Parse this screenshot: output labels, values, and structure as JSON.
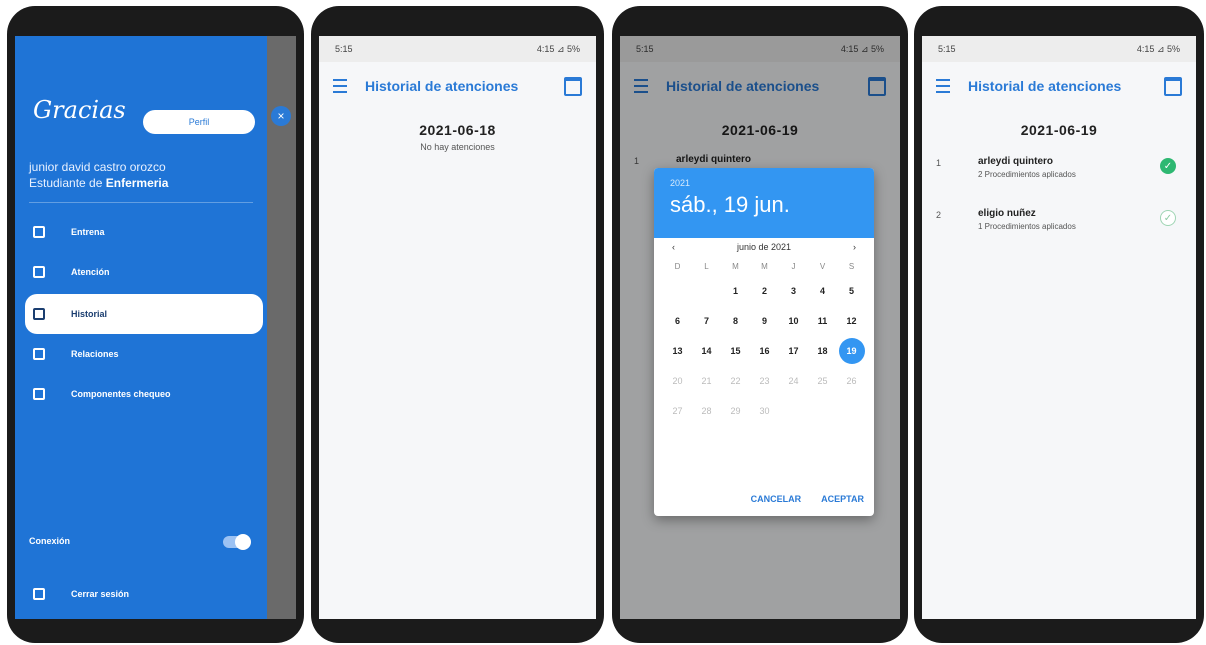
{
  "status": {
    "time": "5:15",
    "right": "4:15 ⊿ 5%"
  },
  "appbar_title": "Historial de atenciones",
  "drawer": {
    "logo": "Gracias",
    "profile_button": "Perfil",
    "close_glyph": "×",
    "user_name": "junior david castro orozco",
    "role_prefix": "Estudiante de",
    "role_bold": "Enfermeria",
    "items": [
      {
        "label": "Entrena",
        "icon": "calendar-icon"
      },
      {
        "label": "Atención",
        "icon": "person-icon"
      },
      {
        "label": "Historial",
        "icon": "history-icon"
      },
      {
        "label": "Relaciones",
        "icon": "relations-icon"
      },
      {
        "label": "Componentes chequeo",
        "icon": "checklist-icon"
      }
    ],
    "connection_label": "Conexión",
    "logout_label": "Cerrar sesión"
  },
  "screen2": {
    "date": "2021-06-18",
    "empty": "No hay atenciones"
  },
  "screen3": {
    "date": "2021-06-19",
    "behind_name": "arleydi quintero",
    "behind_num": "1",
    "dialog": {
      "year": "2021",
      "bigdate": "sáb., 19 jun.",
      "month": "junio de 2021",
      "prev": "‹",
      "next": "›",
      "dows": [
        "D",
        "L",
        "M",
        "M",
        "J",
        "V",
        "S"
      ],
      "days": [
        "",
        "",
        "1",
        "2",
        "3",
        "4",
        "5",
        "6",
        "7",
        "8",
        "9",
        "10",
        "11",
        "12",
        "13",
        "14",
        "15",
        "16",
        "17",
        "18",
        "19",
        "20",
        "21",
        "22",
        "23",
        "24",
        "25",
        "26",
        "27",
        "28",
        "29",
        "30",
        "",
        "",
        ""
      ],
      "selected": "19",
      "cancel": "CANCELAR",
      "accept": "ACEPTAR"
    }
  },
  "screen4": {
    "date": "2021-06-19",
    "rows": [
      {
        "num": "1",
        "name": "arleydi quintero",
        "detail": "2 Procedimientos aplicados",
        "done": true
      },
      {
        "num": "2",
        "name": "eligio nuñez",
        "detail": "1 Procedimientos aplicados",
        "done": false
      }
    ],
    "check_glyph": "✓"
  }
}
